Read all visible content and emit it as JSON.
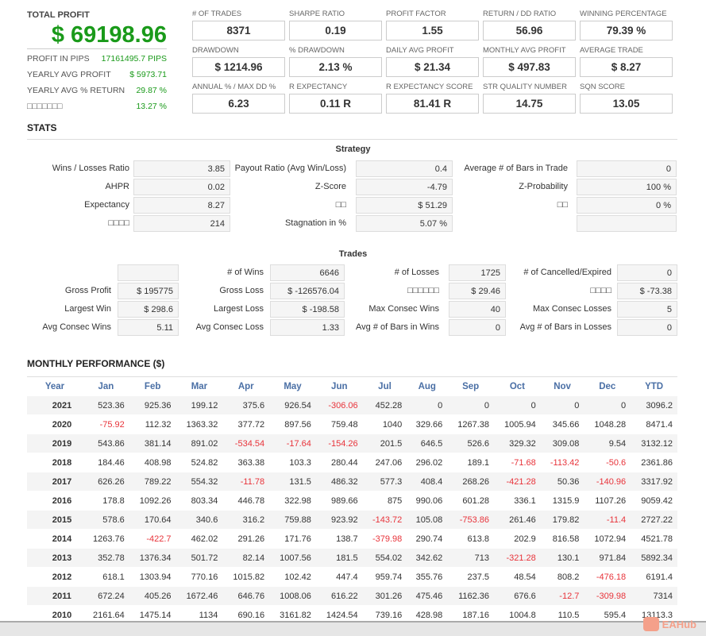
{
  "summary": {
    "total_profit_label": "TOTAL PROFIT",
    "total_profit": "$ 69198.96",
    "rows": [
      {
        "label": "PROFIT IN PIPS",
        "value": "17161495.7 PIPS"
      },
      {
        "label": "YEARLY AVG PROFIT",
        "value": "$ 5973.71"
      },
      {
        "label": "YEARLY AVG % RETURN",
        "value": "29.87 %"
      },
      {
        "label": "□□□□□□□",
        "value": "13.27 %"
      }
    ]
  },
  "metrics": [
    {
      "label": "# OF TRADES",
      "value": "8371"
    },
    {
      "label": "SHARPE RATIO",
      "value": "0.19"
    },
    {
      "label": "PROFIT FACTOR",
      "value": "1.55"
    },
    {
      "label": "RETURN / DD RATIO",
      "value": "56.96"
    },
    {
      "label": "WINNING PERCENTAGE",
      "value": "79.39 %"
    },
    {
      "label": "DRAWDOWN",
      "value": "$ 1214.96"
    },
    {
      "label": "% DRAWDOWN",
      "value": "2.13 %"
    },
    {
      "label": "DAILY AVG PROFIT",
      "value": "$ 21.34"
    },
    {
      "label": "MONTHLY AVG PROFIT",
      "value": "$ 497.83"
    },
    {
      "label": "AVERAGE TRADE",
      "value": "$ 8.27"
    },
    {
      "label": "ANNUAL % / MAX DD %",
      "value": "6.23"
    },
    {
      "label": "R EXPECTANCY",
      "value": "0.11 R"
    },
    {
      "label": "R EXPECTANCY SCORE",
      "value": "81.41 R"
    },
    {
      "label": "STR QUALITY NUMBER",
      "value": "14.75"
    },
    {
      "label": "SQN SCORE",
      "value": "13.05"
    }
  ],
  "stats_title": "STATS",
  "strategy": {
    "title": "Strategy",
    "rows": [
      [
        {
          "label": "Wins / Losses Ratio",
          "value": "3.85"
        },
        {
          "label": "Payout Ratio (Avg Win/Loss)",
          "value": "0.4"
        },
        {
          "label": "Average # of Bars in Trade",
          "value": "0"
        }
      ],
      [
        {
          "label": "AHPR",
          "value": "0.02"
        },
        {
          "label": "Z-Score",
          "value": "-4.79"
        },
        {
          "label": "Z-Probability",
          "value": "100 %"
        }
      ],
      [
        {
          "label": "Expectancy",
          "value": "8.27"
        },
        {
          "label": "□□",
          "value": "$ 51.29"
        },
        {
          "label": "□□",
          "value": "0 %"
        }
      ],
      [
        {
          "label": "□□□□",
          "value": "214"
        },
        {
          "label": "Stagnation in %",
          "value": "5.07 %"
        },
        {
          "label": "",
          "value": ""
        }
      ]
    ]
  },
  "trades": {
    "title": "Trades",
    "rows": [
      [
        {
          "label": "",
          "value": ""
        },
        {
          "label": "# of Wins",
          "value": "6646"
        },
        {
          "label": "# of Losses",
          "value": "1725"
        },
        {
          "label": "# of Cancelled/Expired",
          "value": "0"
        }
      ],
      [
        {
          "label": "Gross Profit",
          "value": "$ 195775"
        },
        {
          "label": "Gross Loss",
          "value": "$ -126576.04"
        },
        {
          "label": "□□□□□□",
          "value": "$ 29.46"
        },
        {
          "label": "□□□□",
          "value": "$ -73.38"
        }
      ],
      [
        {
          "label": "Largest Win",
          "value": "$ 298.6"
        },
        {
          "label": "Largest Loss",
          "value": "$ -198.58"
        },
        {
          "label": "Max Consec Wins",
          "value": "40"
        },
        {
          "label": "Max Consec Losses",
          "value": "5"
        }
      ],
      [
        {
          "label": "Avg Consec Wins",
          "value": "5.11"
        },
        {
          "label": "Avg Consec Loss",
          "value": "1.33"
        },
        {
          "label": "Avg # of Bars in Wins",
          "value": "0"
        },
        {
          "label": "Avg # of Bars in Losses",
          "value": "0"
        }
      ]
    ]
  },
  "monthly": {
    "title": "MONTHLY PERFORMANCE ($)",
    "headers": [
      "Year",
      "Jan",
      "Feb",
      "Mar",
      "Apr",
      "May",
      "Jun",
      "Jul",
      "Aug",
      "Sep",
      "Oct",
      "Nov",
      "Dec",
      "YTD"
    ],
    "rows": [
      [
        "2021",
        "523.36",
        "925.36",
        "199.12",
        "375.6",
        "926.54",
        "-306.06",
        "452.28",
        "0",
        "0",
        "0",
        "0",
        "0",
        "3096.2"
      ],
      [
        "2020",
        "-75.92",
        "112.32",
        "1363.32",
        "377.72",
        "897.56",
        "759.48",
        "1040",
        "329.66",
        "1267.38",
        "1005.94",
        "345.66",
        "1048.28",
        "8471.4"
      ],
      [
        "2019",
        "543.86",
        "381.14",
        "891.02",
        "-534.54",
        "-17.64",
        "-154.26",
        "201.5",
        "646.5",
        "526.6",
        "329.32",
        "309.08",
        "9.54",
        "3132.12"
      ],
      [
        "2018",
        "184.46",
        "408.98",
        "524.82",
        "363.38",
        "103.3",
        "280.44",
        "247.06",
        "296.02",
        "189.1",
        "-71.68",
        "-113.42",
        "-50.6",
        "2361.86"
      ],
      [
        "2017",
        "626.26",
        "789.22",
        "554.32",
        "-11.78",
        "131.5",
        "486.32",
        "577.3",
        "408.4",
        "268.26",
        "-421.28",
        "50.36",
        "-140.96",
        "3317.92"
      ],
      [
        "2016",
        "178.8",
        "1092.26",
        "803.34",
        "446.78",
        "322.98",
        "989.66",
        "875",
        "990.06",
        "601.28",
        "336.1",
        "1315.9",
        "1107.26",
        "9059.42"
      ],
      [
        "2015",
        "578.6",
        "170.64",
        "340.6",
        "316.2",
        "759.88",
        "923.92",
        "-143.72",
        "105.08",
        "-753.86",
        "261.46",
        "179.82",
        "-11.4",
        "2727.22"
      ],
      [
        "2014",
        "1263.76",
        "-422.7",
        "462.02",
        "291.26",
        "171.76",
        "138.7",
        "-379.98",
        "290.74",
        "613.8",
        "202.9",
        "816.58",
        "1072.94",
        "4521.78"
      ],
      [
        "2013",
        "352.78",
        "1376.34",
        "501.72",
        "82.14",
        "1007.56",
        "181.5",
        "554.02",
        "342.62",
        "713",
        "-321.28",
        "130.1",
        "971.84",
        "5892.34"
      ],
      [
        "2012",
        "618.1",
        "1303.94",
        "770.16",
        "1015.82",
        "102.42",
        "447.4",
        "959.74",
        "355.76",
        "237.5",
        "48.54",
        "808.2",
        "-476.18",
        "6191.4"
      ],
      [
        "2011",
        "672.24",
        "405.26",
        "1672.46",
        "646.76",
        "1008.06",
        "616.22",
        "301.26",
        "475.46",
        "1162.36",
        "676.6",
        "-12.7",
        "-309.98",
        "7314"
      ],
      [
        "2010",
        "2161.64",
        "1475.14",
        "1134",
        "690.16",
        "3161.82",
        "1424.54",
        "739.16",
        "428.98",
        "187.16",
        "1004.8",
        "110.5",
        "595.4",
        "13113.3"
      ]
    ]
  },
  "watermark": "EAHub",
  "colors": {
    "profit": "#1a9a1a",
    "negative": "#e8333a",
    "header": "#4a6fa5"
  }
}
